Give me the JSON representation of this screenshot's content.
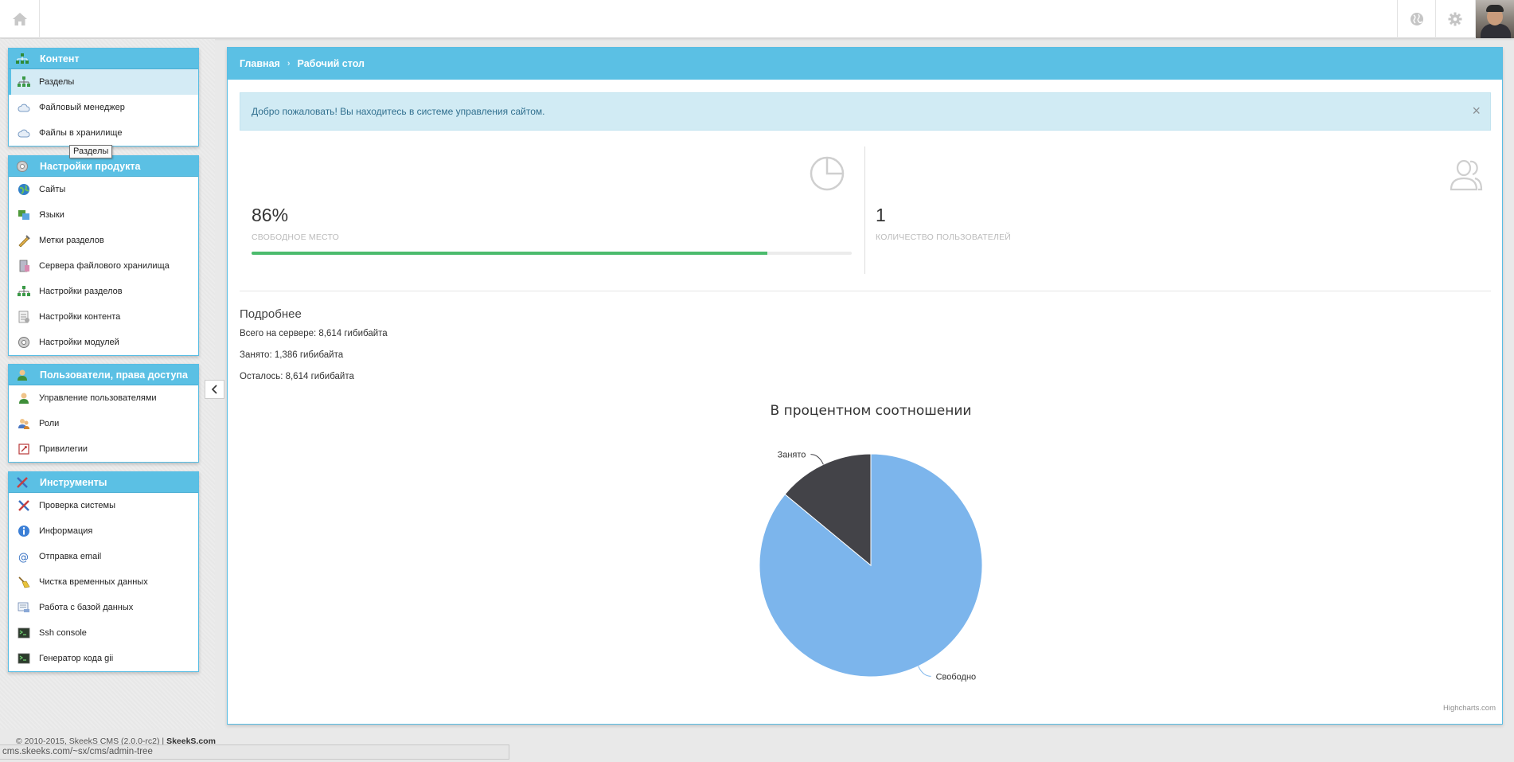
{
  "topbar": {
    "home_icon": "home-icon",
    "globe_icon": "globe-icon",
    "gear_icon": "gear-icon"
  },
  "sidebar": {
    "tooltip": "Разделы",
    "groups": [
      {
        "title": "Контент",
        "icon": "sitemap-icon",
        "items": [
          {
            "label": "Разделы",
            "icon": "sitemap-icon",
            "active": true
          },
          {
            "label": "Файловый менеджер",
            "icon": "cloud-icon"
          },
          {
            "label": "Файлы в хранилище",
            "icon": "cloud-icon"
          }
        ]
      },
      {
        "title": "Настройки продукта",
        "icon": "gear-icon",
        "items": [
          {
            "label": "Сайты",
            "icon": "globe-icon"
          },
          {
            "label": "Языки",
            "icon": "language-icon"
          },
          {
            "label": "Метки разделов",
            "icon": "tag-icon"
          },
          {
            "label": "Сервера файлового хранилища",
            "icon": "server-icon"
          },
          {
            "label": "Настройки разделов",
            "icon": "sitemap-icon"
          },
          {
            "label": "Настройки контента",
            "icon": "document-icon"
          },
          {
            "label": "Настройки модулей",
            "icon": "gear-icon"
          }
        ]
      },
      {
        "title": "Пользователи, права доступа",
        "icon": "user-icon",
        "items": [
          {
            "label": "Управление пользователями",
            "icon": "user-icon"
          },
          {
            "label": "Роли",
            "icon": "users-icon"
          },
          {
            "label": "Привилегии",
            "icon": "key-icon"
          }
        ]
      },
      {
        "title": "Инструменты",
        "icon": "tools-icon",
        "items": [
          {
            "label": "Проверка системы",
            "icon": "tools-icon"
          },
          {
            "label": "Информация",
            "icon": "info-icon"
          },
          {
            "label": "Отправка email",
            "icon": "email-icon"
          },
          {
            "label": "Чистка временных данных",
            "icon": "broom-icon"
          },
          {
            "label": "Работа с базой данных",
            "icon": "database-icon"
          },
          {
            "label": "Ssh console",
            "icon": "terminal-icon"
          },
          {
            "label": "Генератор кода gii",
            "icon": "terminal-icon"
          }
        ]
      }
    ]
  },
  "main": {
    "breadcrumb": {
      "home": "Главная",
      "separator": "›",
      "current": "Рабочий стол"
    },
    "alert": {
      "text": "Добро пожаловать! Вы находитесь в системе управления сайтом.",
      "close": "×"
    },
    "stats": {
      "free_space": {
        "value": "86%",
        "label": "СВОБОДНОЕ МЕСТО",
        "percent": 86
      },
      "users": {
        "value": "1",
        "label": "КОЛИЧЕСТВО ПОЛЬЗОВАТЕЛЕЙ"
      }
    },
    "details": {
      "title": "Подробнее",
      "total": "Всего на сервере: 8,614 гибибайта",
      "used": "Занято: 1,386 гибибайта",
      "remaining": "Осталось: 8,614 гибибайта"
    }
  },
  "chart_data": {
    "type": "pie",
    "title": "В процентном соотношении",
    "slices": [
      {
        "label": "Свободно",
        "value": 86,
        "color": "#7cb5ec"
      },
      {
        "label": "Занято",
        "value": 14,
        "color": "#434348"
      }
    ],
    "credits": "Highcharts.com"
  },
  "footer": {
    "copyright": "© 2010-2015, SkeekS CMS (2.0.0-rc2) |",
    "brand": "SkeekS.com",
    "status_url": "cms.skeeks.com/~sx/cms/admin-tree"
  },
  "colors": {
    "accent": "#5bc0e4",
    "progress": "#4bbb6d",
    "alert_bg": "#d1ebf4",
    "alert_text": "#31708f"
  }
}
